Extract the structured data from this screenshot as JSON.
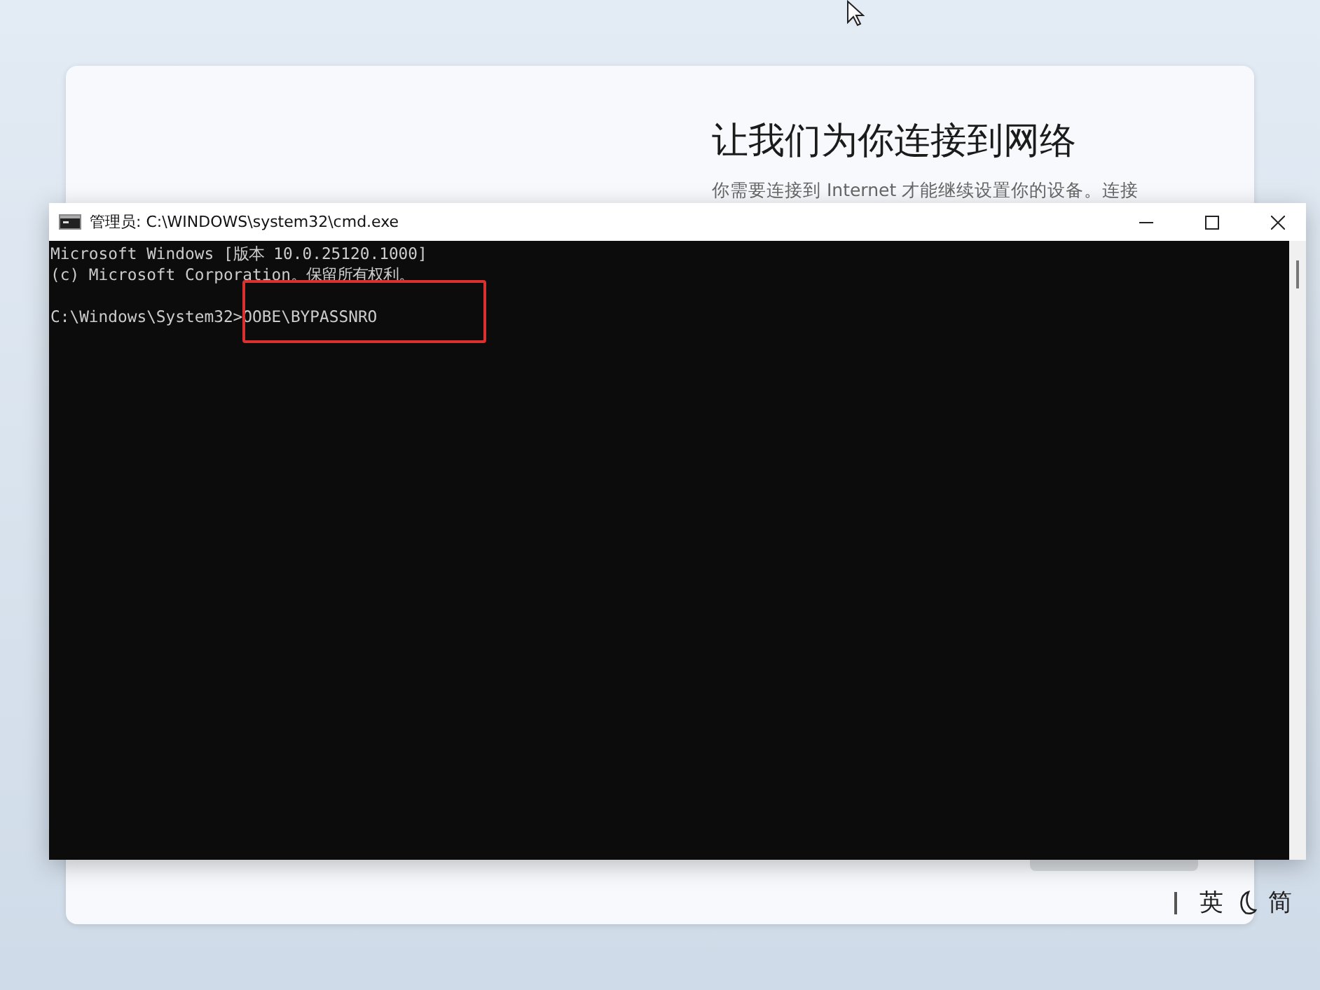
{
  "setup": {
    "heading": "让我们为你连接到网络",
    "subtitle": "你需要连接到 Internet 才能继续设置你的设备。连接"
  },
  "console_window": {
    "title": "管理员: C:\\WINDOWS\\system32\\cmd.exe",
    "lines": [
      {
        "kind": "output",
        "text": "Microsoft Windows [版本 10.0.25120.1000]"
      },
      {
        "kind": "output",
        "text": "(c) Microsoft Corporation。保留所有权利。"
      },
      {
        "kind": "blank"
      },
      {
        "kind": "prompt",
        "prompt": "C:\\Windows\\System32>",
        "command": "OOBE\\BYPASSNRO",
        "highlighted": true
      }
    ]
  },
  "input_bar": {
    "items": [
      "英",
      "简"
    ]
  }
}
